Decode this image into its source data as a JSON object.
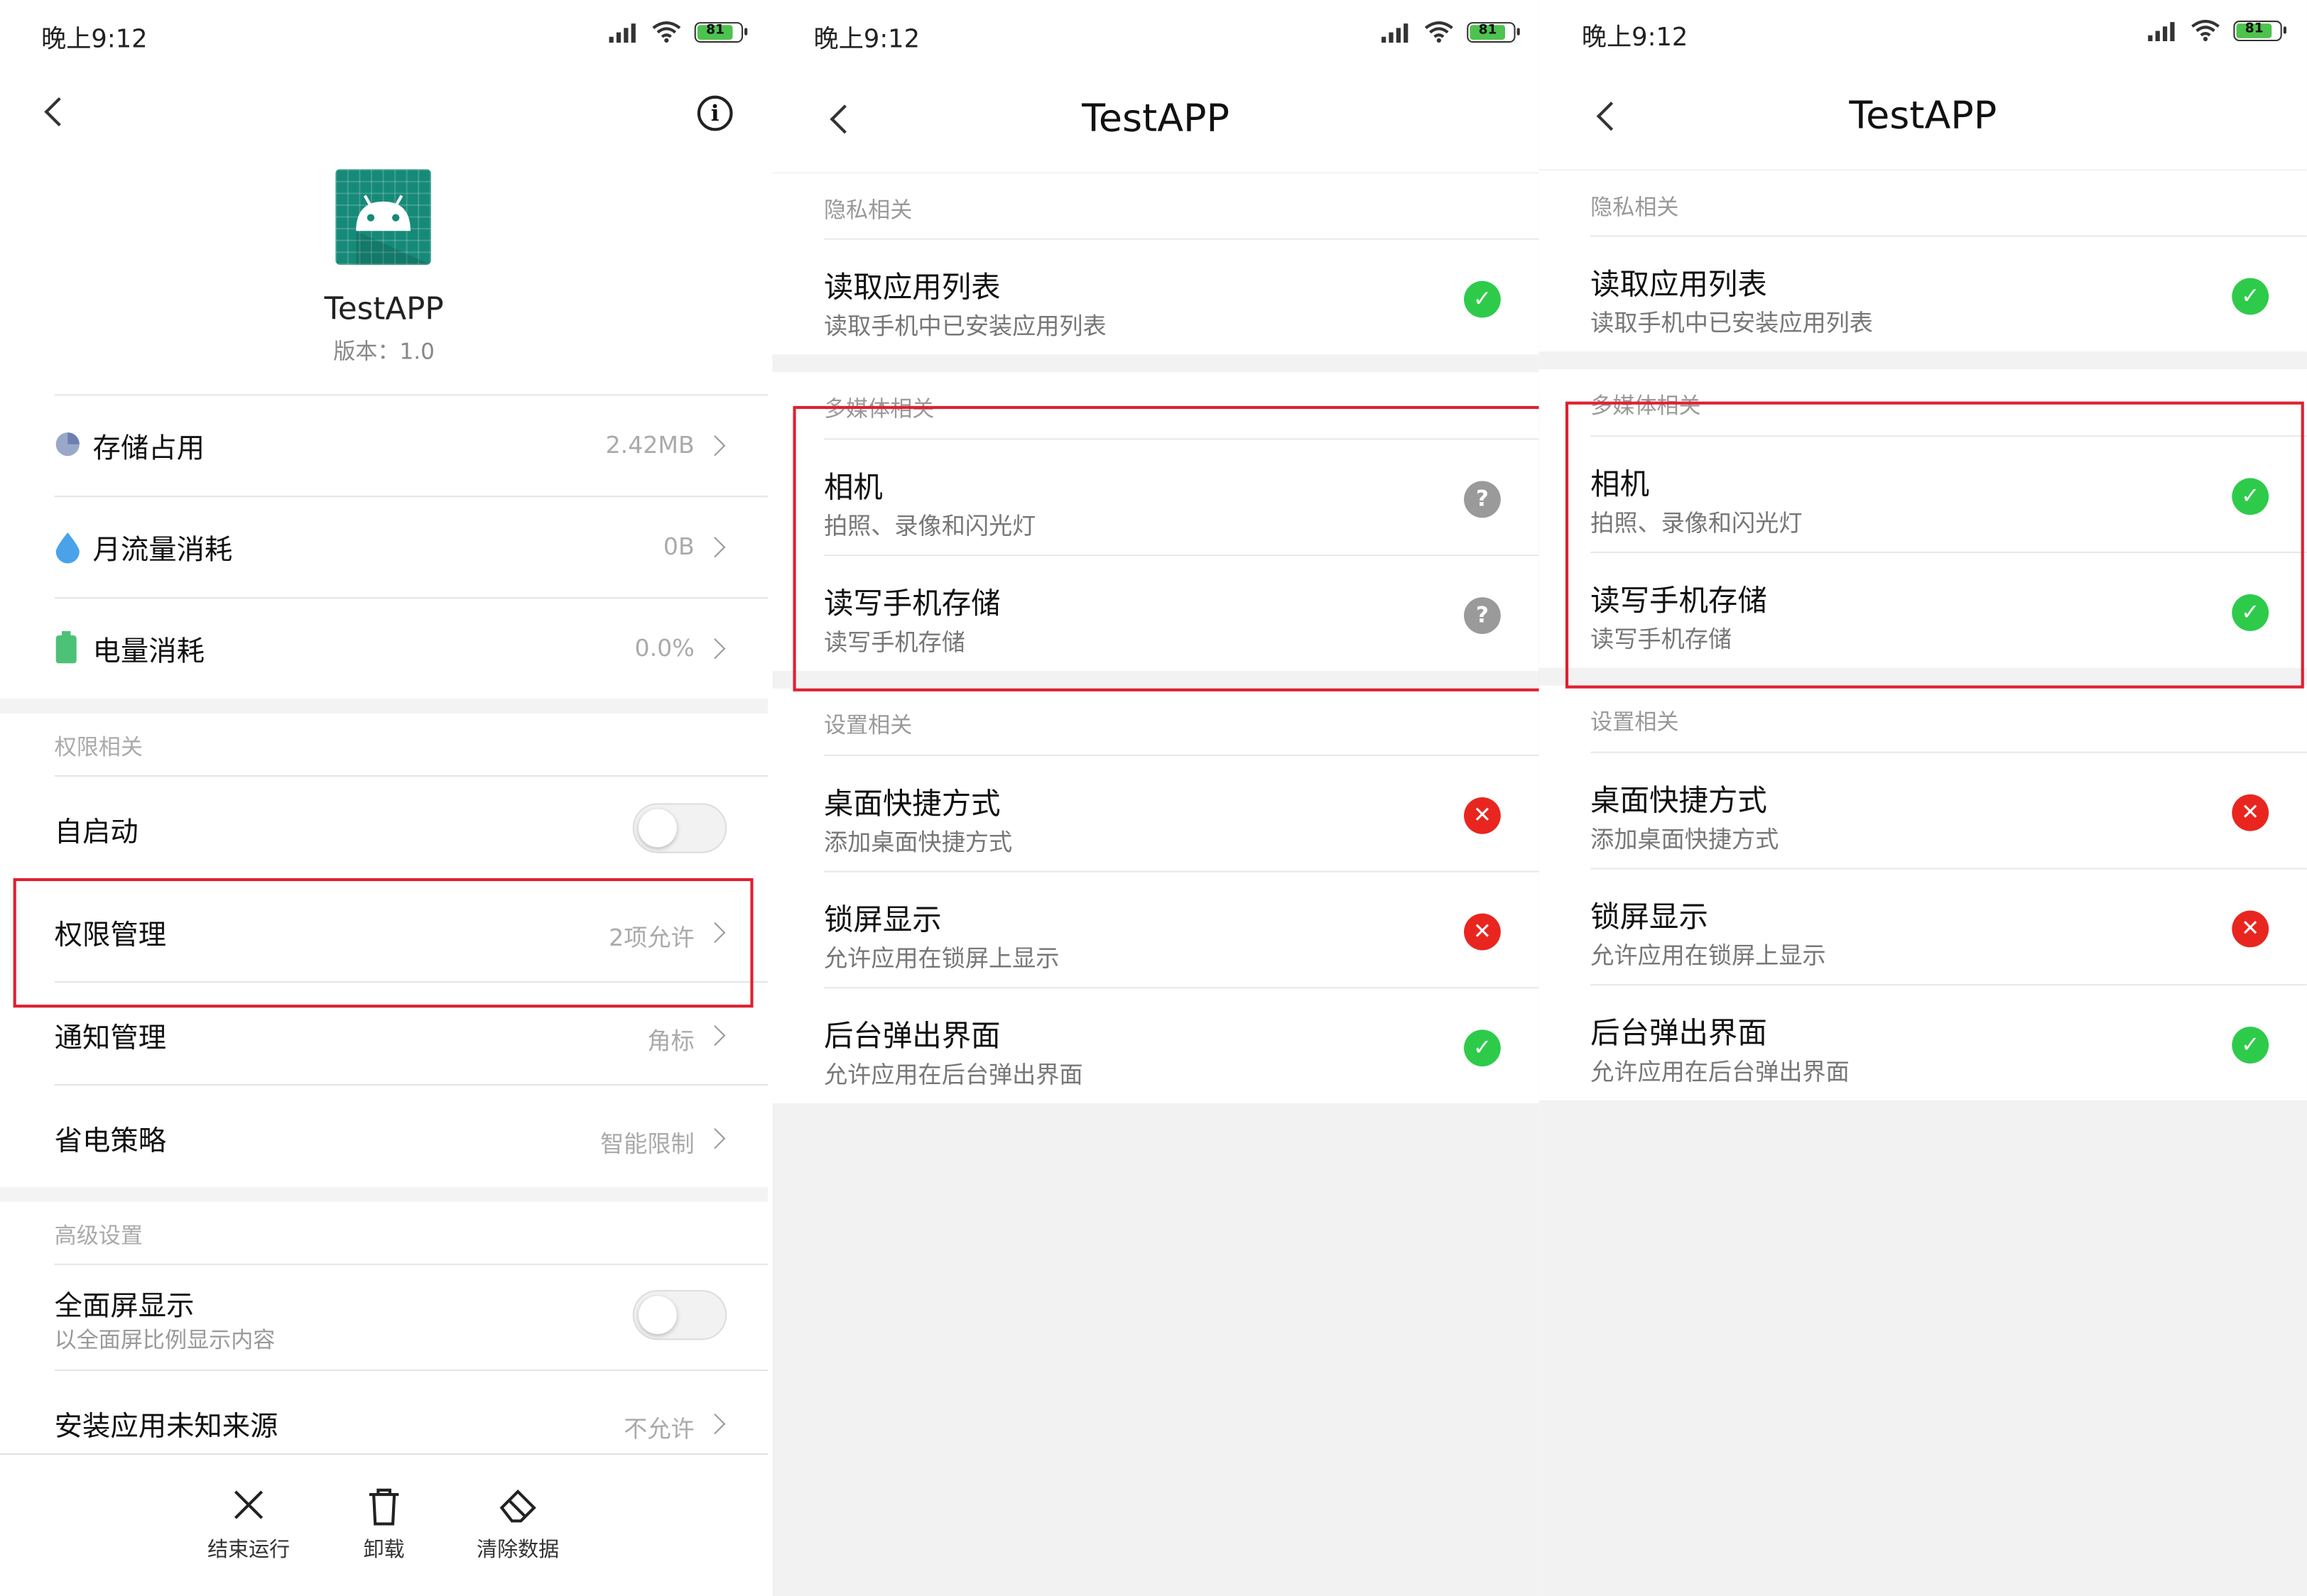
{
  "status_time": "晚上9:12",
  "battery": "81",
  "app": {
    "name": "TestAPP",
    "version": "版本：1.0"
  },
  "detail": {
    "rows": [
      {
        "label": "存储占用",
        "value": "2.42MB"
      },
      {
        "label": "月流量消耗",
        "value": "0B"
      },
      {
        "label": "电量消耗",
        "value": "0.0%"
      }
    ],
    "section_permissions": "权限相关",
    "autostart_label": "自启动",
    "perm_mgmt": {
      "label": "权限管理",
      "value": "2项允许"
    },
    "notify_mgmt": {
      "label": "通知管理",
      "value": "角标"
    },
    "power_policy": {
      "label": "省电策略",
      "value": "智能限制"
    },
    "section_advanced": "高级设置",
    "fullscreen": {
      "label": "全面屏显示",
      "sub": "以全面屏比例显示内容"
    },
    "unknown_sources": {
      "label": "安装应用未知来源",
      "value": "不允许"
    },
    "bottom": {
      "stop": "结束运行",
      "uninstall": "卸载",
      "clear": "清除数据"
    }
  },
  "perm_screen": {
    "title": "TestAPP",
    "sec_privacy": "隐私相关",
    "sec_media": "多媒体相关",
    "sec_settings": "设置相关",
    "items": {
      "applist": {
        "label": "读取应用列表",
        "sub": "读取手机中已安装应用列表"
      },
      "camera": {
        "label": "相机",
        "sub": "拍照、录像和闪光灯"
      },
      "storage": {
        "label": "读写手机存储",
        "sub": "读写手机存储"
      },
      "shortcut": {
        "label": "桌面快捷方式",
        "sub": "添加桌面快捷方式"
      },
      "lockscreen": {
        "label": "锁屏显示",
        "sub": "允许应用在锁屏上显示"
      },
      "popup": {
        "label": "后台弹出界面",
        "sub": "允许应用在后台弹出界面"
      }
    }
  },
  "screen2_status": {
    "applist": "allowed",
    "camera": "ask",
    "storage": "ask",
    "shortcut": "denied",
    "lockscreen": "denied",
    "popup": "allowed"
  },
  "screen3_status": {
    "applist": "allowed",
    "camera": "allowed",
    "storage": "allowed",
    "shortcut": "denied",
    "lockscreen": "denied",
    "popup": "allowed"
  },
  "colors": {
    "allowed": "#2ecb4b",
    "denied": "#e8261f",
    "ask": "#9a9a9a",
    "highlight": "#e02030"
  }
}
